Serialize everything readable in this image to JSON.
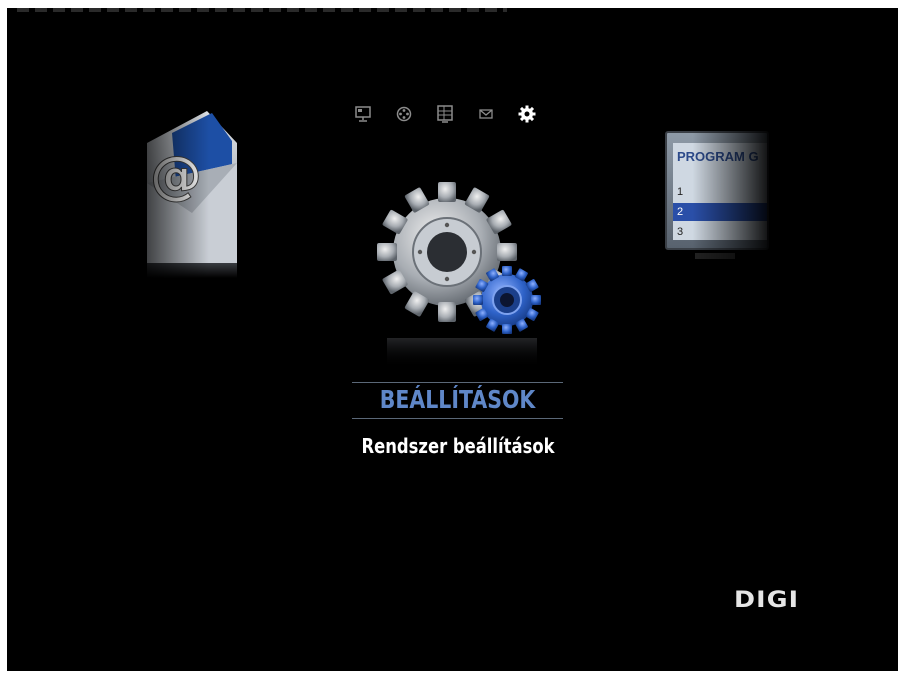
{
  "top_nav": {
    "items": [
      {
        "icon": "tv-screen-icon",
        "selected": false
      },
      {
        "icon": "film-reel-icon",
        "selected": false
      },
      {
        "icon": "program-guide-icon",
        "selected": false
      },
      {
        "icon": "mail-icon",
        "selected": false
      },
      {
        "icon": "gear-icon",
        "selected": true
      }
    ]
  },
  "left_preview": {
    "icon": "email-envelope-icon",
    "symbol": "@"
  },
  "right_preview": {
    "icon": "program-list-icon",
    "title": "PROGRAM G",
    "rows": [
      "1",
      "2",
      "3"
    ],
    "selected_row": "2"
  },
  "selected_menu": {
    "title": "BEÁLLÍTÁSOK",
    "subtitle": "Rendszer beállítások",
    "icon": "settings-gears-icon"
  },
  "brand": {
    "logo_text": "DIGI"
  },
  "colors": {
    "background": "#000000",
    "accent": "#5f87c8",
    "highlight": "#2a4fa8"
  }
}
